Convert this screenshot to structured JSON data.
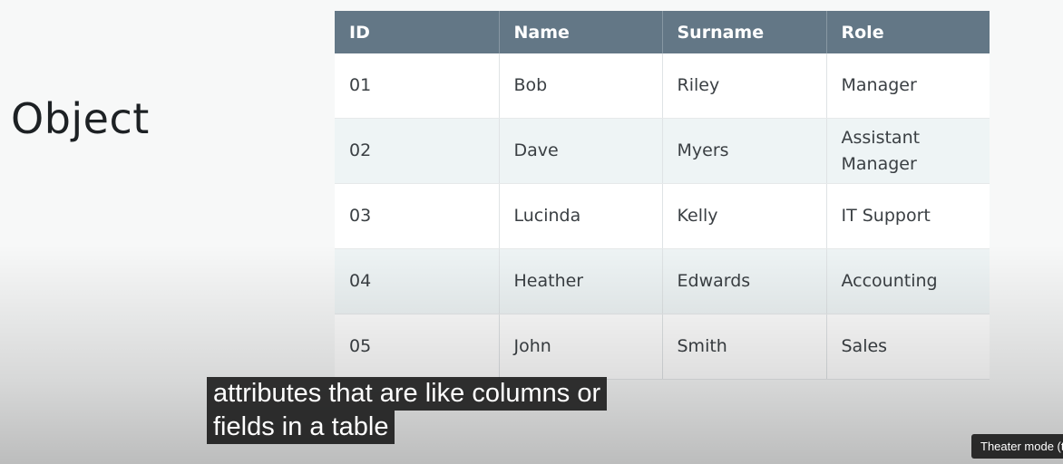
{
  "slide": {
    "title": "Object"
  },
  "table": {
    "headers": [
      "ID",
      "Name",
      "Surname",
      "Role"
    ],
    "rows": [
      [
        "01",
        "Bob",
        "Riley",
        "Manager"
      ],
      [
        "02",
        "Dave",
        "Myers",
        "Assistant Manager"
      ],
      [
        "03",
        "Lucinda",
        "Kelly",
        "IT Support"
      ],
      [
        "04",
        "Heather",
        "Edwards",
        "Accounting"
      ],
      [
        "05",
        "John",
        "Smith",
        "Sales"
      ]
    ]
  },
  "captions": {
    "line1": "attributes that are like columns or",
    "line2": "fields in a table"
  },
  "tooltip": {
    "text": "Theater mode (t)"
  },
  "colors": {
    "header_bg": "#637786",
    "row_alt_bg": "#eef4f5",
    "caption_bg": "#080808"
  }
}
